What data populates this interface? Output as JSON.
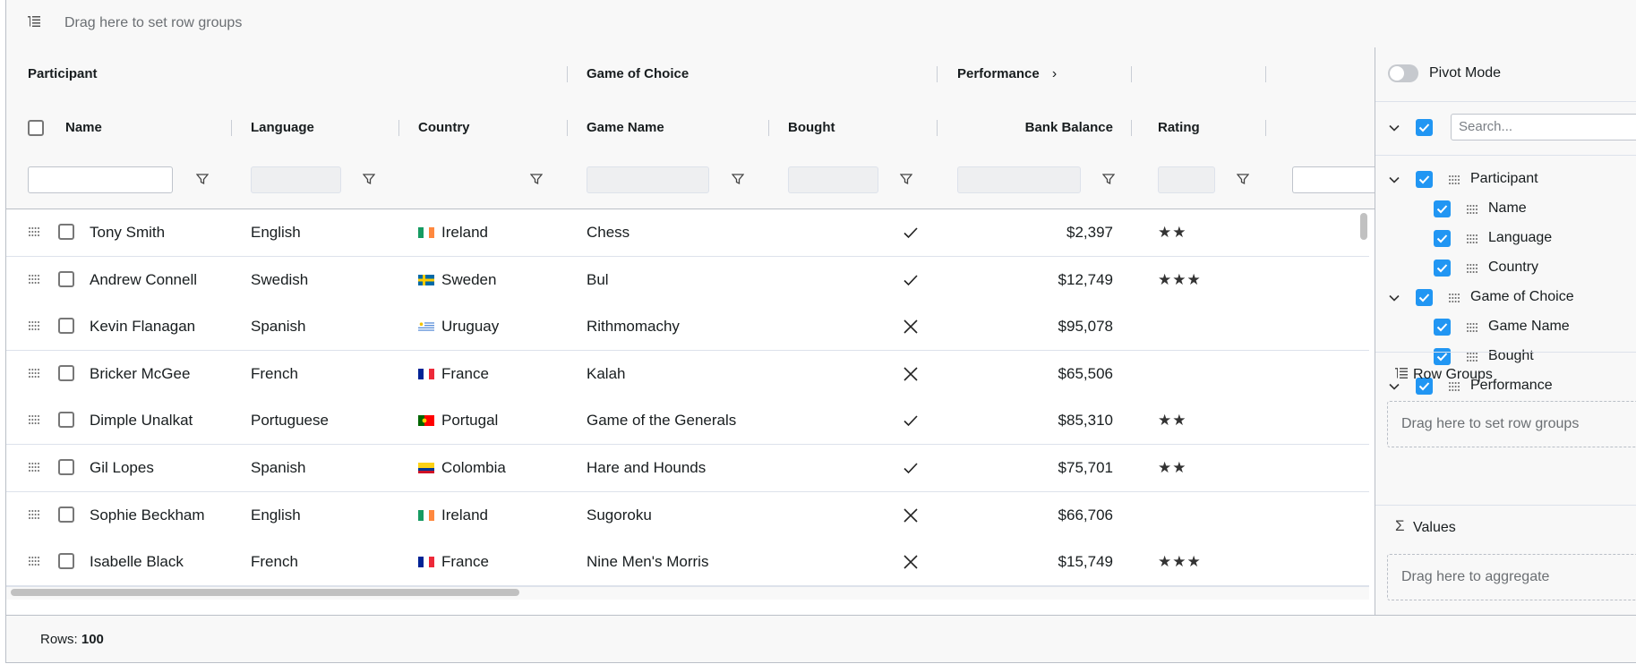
{
  "row_group_bar": {
    "placeholder": "Drag here to set row groups"
  },
  "group_headers": {
    "participant": "Participant",
    "game_of_choice": "Game of Choice",
    "performance": "Performance"
  },
  "columns": {
    "name": "Name",
    "language": "Language",
    "country": "Country",
    "game_name": "Game Name",
    "bought": "Bought",
    "bank_balance": "Bank Balance",
    "rating": "Rating"
  },
  "rows": [
    {
      "name": "Tony Smith",
      "language": "English",
      "country": "Ireland",
      "flag": "ireland",
      "game": "Chess",
      "bought": true,
      "balance": "$2,397",
      "rating": "★★"
    },
    {
      "name": "Andrew Connell",
      "language": "Swedish",
      "country": "Sweden",
      "flag": "sweden",
      "game": "Bul",
      "bought": true,
      "balance": "$12,749",
      "rating": "★★★"
    },
    {
      "name": "Kevin Flanagan",
      "language": "Spanish",
      "country": "Uruguay",
      "flag": "uruguay",
      "game": "Rithmomachy",
      "bought": false,
      "balance": "$95,078",
      "rating": ""
    },
    {
      "name": "Bricker McGee",
      "language": "French",
      "country": "France",
      "flag": "france",
      "game": "Kalah",
      "bought": false,
      "balance": "$65,506",
      "rating": ""
    },
    {
      "name": "Dimple Unalkat",
      "language": "Portuguese",
      "country": "Portugal",
      "flag": "portugal",
      "game": "Game of the Generals",
      "bought": true,
      "balance": "$85,310",
      "rating": "★★"
    },
    {
      "name": "Gil Lopes",
      "language": "Spanish",
      "country": "Colombia",
      "flag": "colombia",
      "game": "Hare and Hounds",
      "bought": true,
      "balance": "$75,701",
      "rating": "★★"
    },
    {
      "name": "Sophie Beckham",
      "language": "English",
      "country": "Ireland",
      "flag": "ireland",
      "game": "Sugoroku",
      "bought": false,
      "balance": "$66,706",
      "rating": ""
    },
    {
      "name": "Isabelle Black",
      "language": "French",
      "country": "France",
      "flag": "france",
      "game": "Nine Men's Morris",
      "bought": false,
      "balance": "$15,749",
      "rating": "★★★"
    }
  ],
  "status_bar": {
    "rows_label": "Rows:",
    "rows_count": "100"
  },
  "tool_panel": {
    "pivot_mode_label": "Pivot Mode",
    "search_placeholder": "Search...",
    "tree": [
      {
        "label": "Participant"
      },
      {
        "label": "Name"
      },
      {
        "label": "Language"
      },
      {
        "label": "Country"
      },
      {
        "label": "Game of Choice"
      },
      {
        "label": "Game Name"
      },
      {
        "label": "Bought"
      },
      {
        "label": "Performance"
      }
    ],
    "row_groups_title": "Row Groups",
    "row_groups_placeholder": "Drag here to set row groups",
    "values_title": "Values",
    "values_placeholder": "Drag here to aggregate"
  },
  "colors": {
    "accent": "#2196f3",
    "border": "#babfc7",
    "header_bg": "#f8f8f8"
  },
  "icons": [
    "row-group-icon",
    "filter-icon",
    "drag-handle-icon",
    "check-icon",
    "cross-icon",
    "chevron-right-icon",
    "chevron-down-icon",
    "sigma-icon"
  ]
}
